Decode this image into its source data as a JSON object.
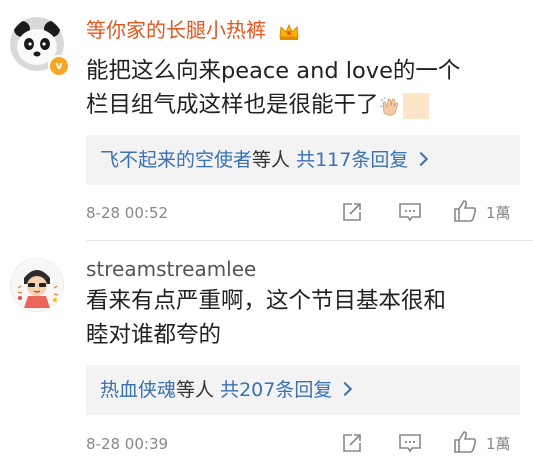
{
  "comments": [
    {
      "username": "等你家的长腿小热裤",
      "content_line1": "能把这么向来peace and love的一个",
      "content_line2": "栏目组气成这样也是很能干了",
      "avatar_badge": "v",
      "reply_user": "飞不起来的空使者",
      "reply_mid": "等人",
      "reply_count": "共117条回复",
      "time": "8-28 00:52",
      "likes": "1萬"
    },
    {
      "username": "streamstreamlee",
      "content_line1": "看来有点严重啊，这个节目基本很和",
      "content_line2": "睦对谁都夸的",
      "reply_user": "热血侠魂",
      "reply_mid": "等人",
      "reply_count": "共207条回复",
      "time": "8-28 00:39",
      "likes": "1萬"
    }
  ],
  "colors": {
    "highlight_username": "#e8541e",
    "link_blue": "#3a71b2",
    "reply_bg": "#f3f3f3",
    "badge_orange": "#f5a623"
  },
  "icons": [
    "panda-avatar",
    "verified-badge-icon",
    "crown-icon",
    "clap-emoji",
    "repost-icon",
    "comment-icon",
    "like-icon",
    "chevron-right-icon"
  ]
}
